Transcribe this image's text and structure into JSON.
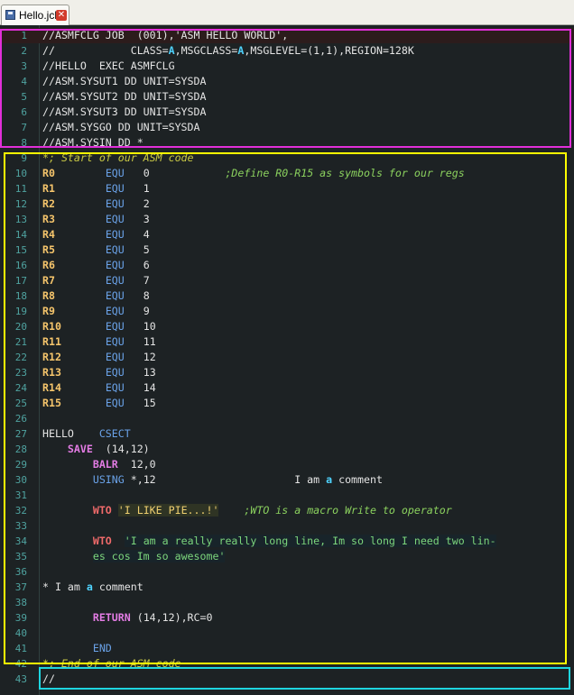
{
  "tab": {
    "title": "Hello.jcl",
    "close": "✕"
  },
  "lines": [
    "//ASMFCLG JOB  (001),'ASM HELLO WORLD',",
    "//            CLASS=A,MSGCLASS=A,MSGLEVEL=(1,1),REGION=128K",
    "//HELLO  EXEC ASMFCLG",
    "//ASM.SYSUT1 DD UNIT=SYSDA",
    "//ASM.SYSUT2 DD UNIT=SYSDA",
    "//ASM.SYSUT3 DD UNIT=SYSDA",
    "//ASM.SYSGO DD UNIT=SYSDA",
    "//ASM.SYSIN DD *",
    "*; Start of our ASM code",
    "R0        EQU   0            ;Define R0-R15 as symbols for our regs",
    "R1        EQU   1",
    "R2        EQU   2",
    "R3        EQU   3",
    "R4        EQU   4",
    "R5        EQU   5",
    "R6        EQU   6",
    "R7        EQU   7",
    "R8        EQU   8",
    "R9        EQU   9",
    "R10       EQU   10",
    "R11       EQU   11",
    "R12       EQU   12",
    "R13       EQU   13",
    "R14       EQU   14",
    "R15       EQU   15",
    "",
    "HELLO    CSECT",
    "    SAVE  (14,12)",
    "        BALR  12,0",
    "        USING *,12                      I am a comment",
    "",
    "        WTO 'I LIKE PIE...!'    ;WTO is a macro Write to operator",
    "",
    "        WTO  'I am a really really long line, Im so long I need two lin-",
    "        es cos Im so awesome'",
    "",
    "* I am a comment",
    "",
    "        RETURN (14,12),RC=0",
    "",
    "        END",
    "*; End of our ASM code",
    "//"
  ],
  "colors": {
    "background": "#1d2224",
    "line_numbers": "#4fa3a0",
    "label": "#f7c66c",
    "opcode": "#6aa2e8",
    "comment": "#8bd15e",
    "macro": "#f06a6a",
    "box_magenta": "#e12fd9",
    "box_yellow": "#ffff00",
    "box_cyan": "#1ed6e0"
  }
}
